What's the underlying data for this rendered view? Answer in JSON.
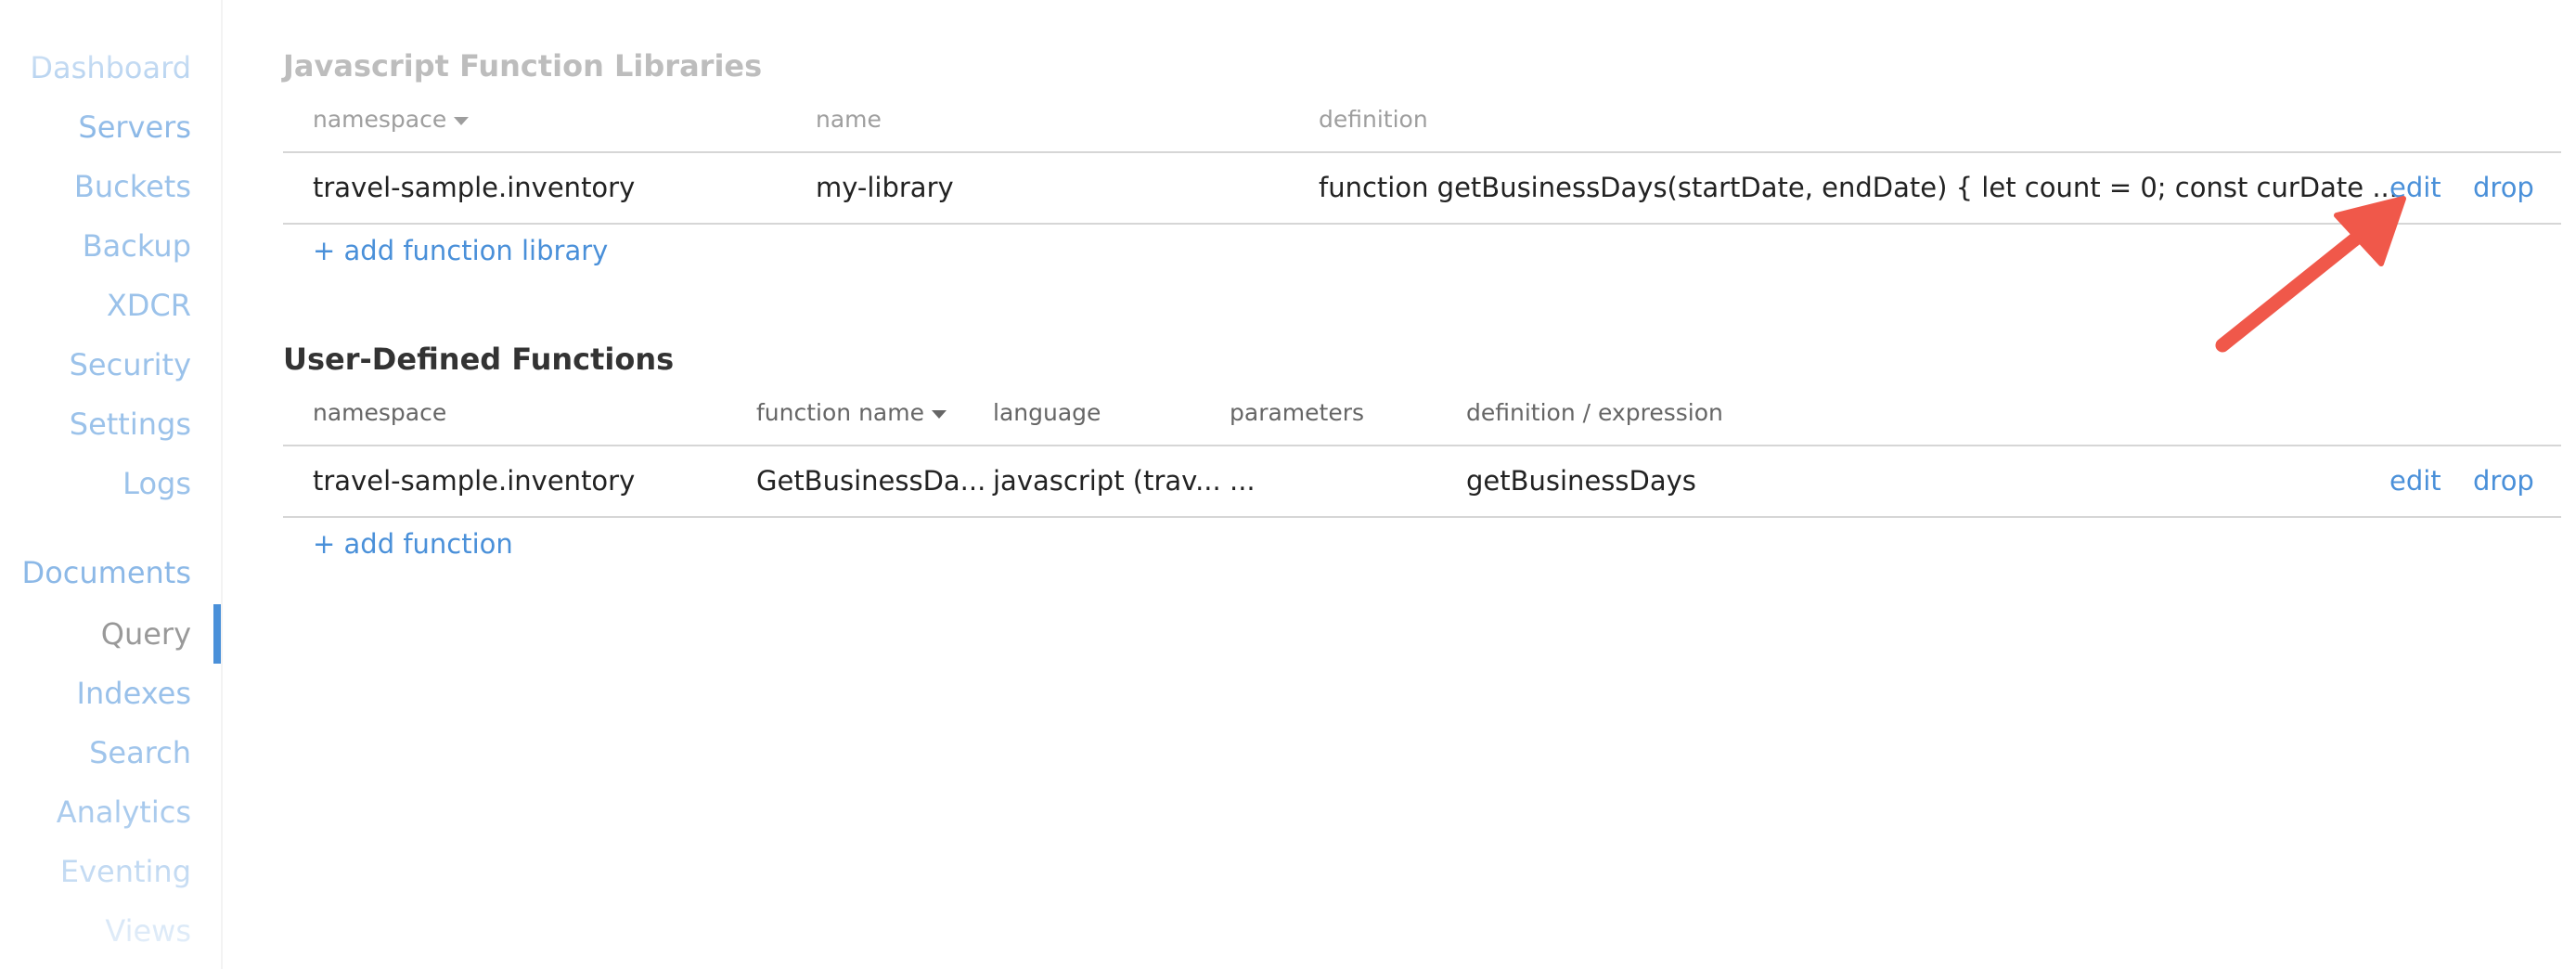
{
  "colors": {
    "link": "#4a90d9",
    "active_indicator": "#4a90d9",
    "annotation_arrow": "#f0584a"
  },
  "sidebar": {
    "items": [
      {
        "label": "Dashboard"
      },
      {
        "label": "Servers"
      },
      {
        "label": "Buckets"
      },
      {
        "label": "Backup"
      },
      {
        "label": "XDCR"
      },
      {
        "label": "Security"
      },
      {
        "label": "Settings"
      },
      {
        "label": "Logs"
      },
      {
        "label": "Documents"
      },
      {
        "label": "Query",
        "active": true
      },
      {
        "label": "Indexes"
      },
      {
        "label": "Search"
      },
      {
        "label": "Analytics"
      },
      {
        "label": "Eventing"
      },
      {
        "label": "Views"
      }
    ]
  },
  "libraries": {
    "title": "Javascript Function Libraries",
    "columns": [
      "namespace",
      "name",
      "definition"
    ],
    "sorted_column": "namespace",
    "rows": [
      {
        "namespace": "travel-sample.inventory",
        "name": "my-library",
        "definition": "function getBusinessDays(startDate, endDate) { let count = 0; const curDate ...",
        "edit": "edit",
        "drop": "drop"
      }
    ],
    "add_label": "+ add function library"
  },
  "udf": {
    "title": "User-Defined Functions",
    "columns": [
      "namespace",
      "function name",
      "language",
      "parameters",
      "definition / expression"
    ],
    "sorted_column": "function name",
    "rows": [
      {
        "namespace": "travel-sample.inventory",
        "function_name": "GetBusinessDa...",
        "language": "javascript (trav...",
        "parameters": "...",
        "definition": "getBusinessDays",
        "edit": "edit",
        "drop": "drop"
      }
    ],
    "add_label": "+ add function"
  },
  "annotation": {
    "icon": "red-arrow-pointing-to-edit"
  }
}
